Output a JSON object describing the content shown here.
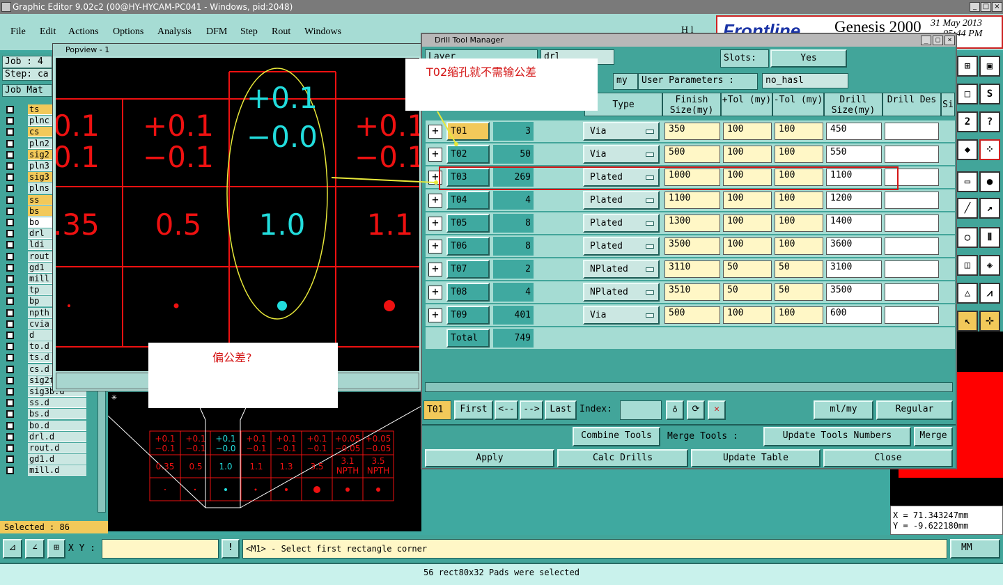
{
  "app": {
    "title": "Graphic Editor 9.02c2 (00@HY-HYCAM-PC041 - Windows, pid:2048)"
  },
  "menu": [
    "File",
    "Edit",
    "Actions",
    "Options",
    "Analysis",
    "DFM",
    "Step",
    "Rout",
    "Windows"
  ],
  "menu_extra": "H l",
  "logo": {
    "brand": "Frontline",
    "product": "Genesis 2000",
    "date": "31 May 2013",
    "time": "05:44 PM"
  },
  "left": {
    "job_label": "Job : 4",
    "step_label": "Step: ca",
    "job_matrix": "Job Mat",
    "layers": [
      "ts",
      "plnc",
      "cs",
      "pln2",
      "sig2",
      "pln3",
      "sig3",
      "plns",
      "ss",
      "bs",
      "bo",
      "drl",
      "ldi",
      "rout",
      "gd1",
      "mill",
      "tp",
      "bp",
      "npth",
      "cvia",
      "d",
      "to.d",
      "ts.d",
      "cs.d",
      "sig2t.d",
      "sig3b.d",
      "ss.d",
      "bs.d",
      "bo.d",
      "drl.d",
      "rout.d",
      "gd1.d",
      "mill.d"
    ],
    "selected": "Selected : 86"
  },
  "popview": {
    "title": "Popview - 1",
    "cells": [
      {
        "top": "0.1",
        "bottom": "0.1",
        "size": ".35"
      },
      {
        "top": "+0.1",
        "bottom": "−0.1",
        "size": "0.5"
      },
      {
        "top": "+0.1",
        "bottom": "−0.0",
        "size": "1.0"
      },
      {
        "top": "+0.1",
        "bottom": "−0.1",
        "size": "1.1"
      }
    ]
  },
  "lower_table": {
    "tol_top": [
      "+0.1",
      "+0.1",
      "+0.1",
      "+0.1",
      "+0.1",
      "+0.1",
      "+0.05",
      "+0.05"
    ],
    "tol_bot": [
      "−0.1",
      "−0.1",
      "−0.0",
      "−0.1",
      "−0.1",
      "−0.1",
      "−0.05",
      "−0.05"
    ],
    "sizes": [
      "0.35",
      "0.5",
      "1.0",
      "1.1",
      "1.3",
      "3.5",
      "3.1 NPTH",
      "3.5 NPTH"
    ]
  },
  "dtm": {
    "title": "Drill Tool Manager",
    "layer_label": "Layer",
    "layer_value": "drl",
    "slots_label": "Slots:",
    "slots_value": "Yes",
    "units_label": "my",
    "user_params_label": "User Parameters :",
    "user_params_value": "no_hasl",
    "headers": {
      "type": "Type",
      "finish": "Finish Size(my)",
      "ptol": "+Tol (my)",
      "mtol": "-Tol (my)",
      "drill": "Drill Size(my)",
      "des": "Drill Des",
      "si": "Si"
    },
    "rows": [
      {
        "tool": "T01",
        "count": "3",
        "type": "Via",
        "finish": "350",
        "ptol": "100",
        "mtol": "100",
        "drill": "450"
      },
      {
        "tool": "T02",
        "count": "50",
        "type": "Via",
        "finish": "500",
        "ptol": "100",
        "mtol": "100",
        "drill": "550"
      },
      {
        "tool": "T03",
        "count": "269",
        "type": "Plated",
        "finish": "1000",
        "ptol": "100",
        "mtol": "100",
        "drill": "1100"
      },
      {
        "tool": "T04",
        "count": "4",
        "type": "Plated",
        "finish": "1100",
        "ptol": "100",
        "mtol": "100",
        "drill": "1200"
      },
      {
        "tool": "T05",
        "count": "8",
        "type": "Plated",
        "finish": "1300",
        "ptol": "100",
        "mtol": "100",
        "drill": "1400"
      },
      {
        "tool": "T06",
        "count": "8",
        "type": "Plated",
        "finish": "3500",
        "ptol": "100",
        "mtol": "100",
        "drill": "3600"
      },
      {
        "tool": "T07",
        "count": "2",
        "type": "NPlated",
        "finish": "3110",
        "ptol": "50",
        "mtol": "50",
        "drill": "3100"
      },
      {
        "tool": "T08",
        "count": "4",
        "type": "NPlated",
        "finish": "3510",
        "ptol": "50",
        "mtol": "50",
        "drill": "3500"
      },
      {
        "tool": "T09",
        "count": "401",
        "type": "Via",
        "finish": "500",
        "ptol": "100",
        "mtol": "100",
        "drill": "600"
      }
    ],
    "total_label": "Total",
    "total_count": "749",
    "current_tool": "T01",
    "nav": {
      "first": "First",
      "prev": "<--",
      "next": "-->",
      "last": "Last",
      "index": "Index:"
    },
    "unit_select": "ml/my",
    "mode_select": "Regular",
    "combine": "Combine Tools",
    "merge_label": "Merge Tools :",
    "merge_select": "Update Tools Numbers",
    "merge_btn": "Merge",
    "apply": "Apply",
    "calc": "Calc Drills",
    "update": "Update Table",
    "close": "Close"
  },
  "notes": {
    "n1": "T02缩孔就不需输公差",
    "n2": "偏公差?"
  },
  "coords": {
    "x": "X = 71.343247mm",
    "y": "Y = -9.622180mm"
  },
  "status": {
    "xy": "X Y :",
    "prompt": "<M1> - Select first rectangle corner",
    "units": "MM"
  },
  "message": "56 rect80x32 Pads were selected",
  "colors": {
    "accent_red": "#ee1111",
    "highlight_cyan": "#22dddd",
    "teal": "#42a59a"
  }
}
